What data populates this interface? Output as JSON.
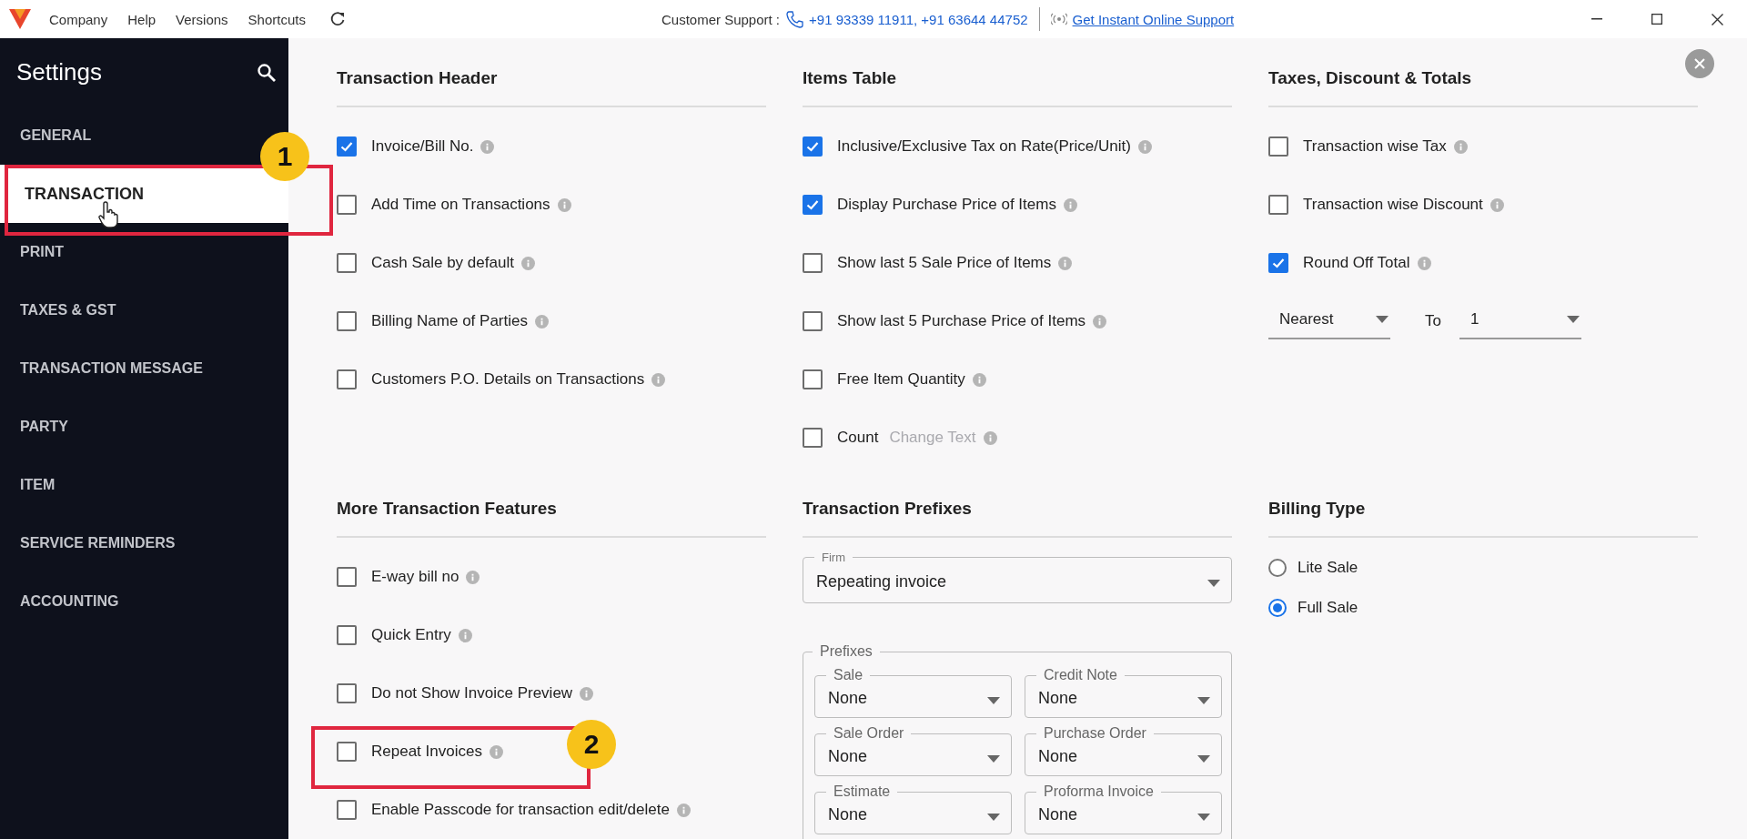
{
  "title_bar": {
    "menu": [
      "Company",
      "Help",
      "Versions",
      "Shortcuts"
    ],
    "support_label": "Customer Support :",
    "support_phones": "+91 93339 11911, +91 63644 44752",
    "support_link": "Get Instant Online Support"
  },
  "sidebar": {
    "title": "Settings",
    "items": [
      {
        "label": "GENERAL",
        "selected": false
      },
      {
        "label": "TRANSACTION",
        "selected": true
      },
      {
        "label": "PRINT",
        "selected": false
      },
      {
        "label": "TAXES & GST",
        "selected": false
      },
      {
        "label": "TRANSACTION MESSAGE",
        "selected": false
      },
      {
        "label": "PARTY",
        "selected": false
      },
      {
        "label": "ITEM",
        "selected": false
      },
      {
        "label": "SERVICE REMINDERS",
        "selected": false
      },
      {
        "label": "ACCOUNTING",
        "selected": false
      }
    ]
  },
  "sections": [
    {
      "title": "Transaction Header",
      "items": [
        {
          "kind": "checkbox",
          "label": "Invoice/Bill No.",
          "checked": true
        },
        {
          "kind": "checkbox",
          "label": "Add Time on Transactions",
          "checked": false
        },
        {
          "kind": "checkbox",
          "label": "Cash Sale by default",
          "checked": false
        },
        {
          "kind": "checkbox",
          "label": "Billing Name of Parties",
          "checked": false
        },
        {
          "kind": "checkbox",
          "label": "Customers P.O. Details on Transactions",
          "checked": false
        }
      ]
    },
    {
      "title": "Items Table",
      "items": [
        {
          "kind": "checkbox",
          "label": "Inclusive/Exclusive Tax on Rate(Price/Unit)",
          "checked": true
        },
        {
          "kind": "checkbox",
          "label": "Display Purchase Price of Items",
          "checked": true
        },
        {
          "kind": "checkbox",
          "label": "Show last 5 Sale Price of Items",
          "checked": false
        },
        {
          "kind": "checkbox",
          "label": "Show last 5 Purchase Price of Items",
          "checked": false
        },
        {
          "kind": "checkbox",
          "label": "Free Item Quantity",
          "checked": false
        },
        {
          "kind": "checkbox",
          "label": "Count",
          "checked": false,
          "link": "Change Text"
        }
      ]
    },
    {
      "title": "Taxes, Discount & Totals",
      "items": [
        {
          "kind": "checkbox",
          "label": "Transaction wise Tax",
          "checked": false
        },
        {
          "kind": "checkbox",
          "label": "Transaction wise Discount",
          "checked": false
        },
        {
          "kind": "checkbox",
          "label": "Round Off Total",
          "checked": true
        },
        {
          "kind": "rounding",
          "mode": "Nearest",
          "to_label": "To",
          "value": "1"
        }
      ]
    },
    {
      "title": "More Transaction Features",
      "items": [
        {
          "kind": "checkbox",
          "label": "E-way bill no",
          "checked": false
        },
        {
          "kind": "checkbox",
          "label": "Quick Entry",
          "checked": false
        },
        {
          "kind": "checkbox",
          "label": "Do not Show Invoice Preview",
          "checked": false
        },
        {
          "kind": "checkbox",
          "label": "Repeat Invoices",
          "checked": false
        },
        {
          "kind": "checkbox",
          "label": "Enable Passcode for transaction edit/delete",
          "checked": false
        }
      ]
    },
    {
      "title": "Transaction Prefixes",
      "items": [
        {
          "kind": "select",
          "label": "Firm",
          "value": "Repeating invoice"
        },
        {
          "kind": "group",
          "label": "Prefixes",
          "fields": [
            {
              "label": "Sale",
              "value": "None"
            },
            {
              "label": "Credit Note",
              "value": "None"
            },
            {
              "label": "Sale Order",
              "value": "None"
            },
            {
              "label": "Purchase Order",
              "value": "None"
            },
            {
              "label": "Estimate",
              "value": "None"
            },
            {
              "label": "Proforma Invoice",
              "value": "None"
            }
          ]
        }
      ]
    },
    {
      "title": "Billing Type",
      "items": [
        {
          "kind": "radio",
          "label": "Lite Sale",
          "selected": false
        },
        {
          "kind": "radio",
          "label": "Full Sale",
          "selected": true
        }
      ]
    }
  ],
  "annotations": [
    {
      "badge": "1"
    },
    {
      "badge": "2"
    }
  ]
}
